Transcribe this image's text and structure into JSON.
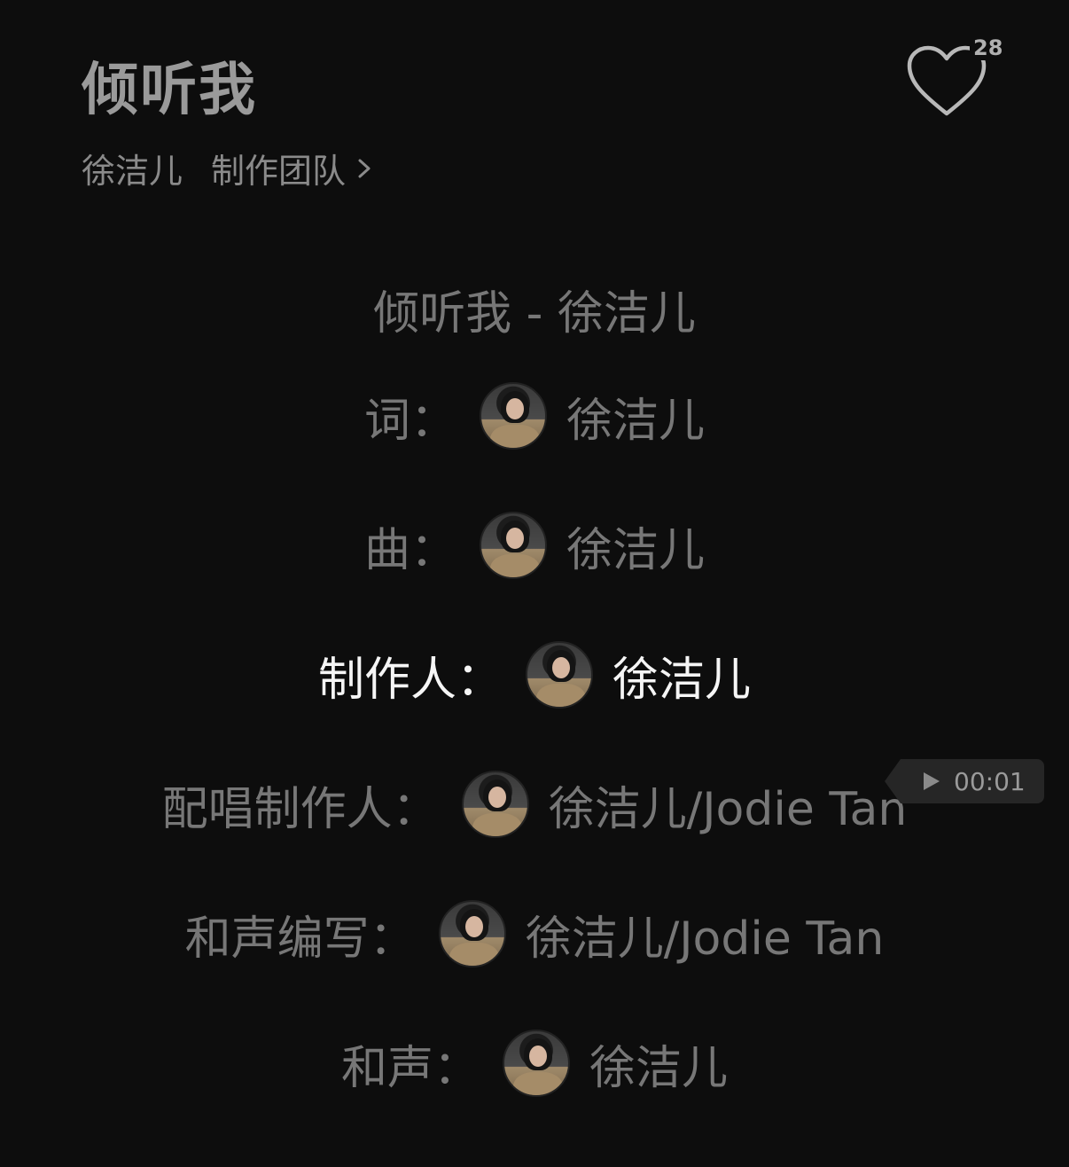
{
  "song": {
    "title": "倾听我",
    "artist": "徐洁儿",
    "team_label": "制作团队"
  },
  "like": {
    "count": "28",
    "icon": "heart-outline-icon"
  },
  "lyrics": [
    {
      "text": "倾听我 - 徐洁儿",
      "has_avatar": false
    },
    {
      "role": "词：",
      "name": "徐洁儿",
      "has_avatar": true
    },
    {
      "role": "曲：",
      "name": "徐洁儿",
      "has_avatar": true
    },
    {
      "role": "制作人：",
      "name": "徐洁儿",
      "has_avatar": true,
      "active": true
    },
    {
      "role": "配唱制作人：",
      "name": "徐洁儿/Jodie Tan",
      "has_avatar": true
    },
    {
      "role": "和声编写：",
      "name": "徐洁儿/Jodie Tan",
      "has_avatar": true
    },
    {
      "role": "和声：",
      "name": "徐洁儿",
      "has_avatar": true
    }
  ],
  "seek": {
    "time": "00:01",
    "icon": "play-icon"
  },
  "colors": {
    "background": "#0d0d0d",
    "active_lyric": "#f5f5f5",
    "inactive_lyric": "#777777"
  }
}
